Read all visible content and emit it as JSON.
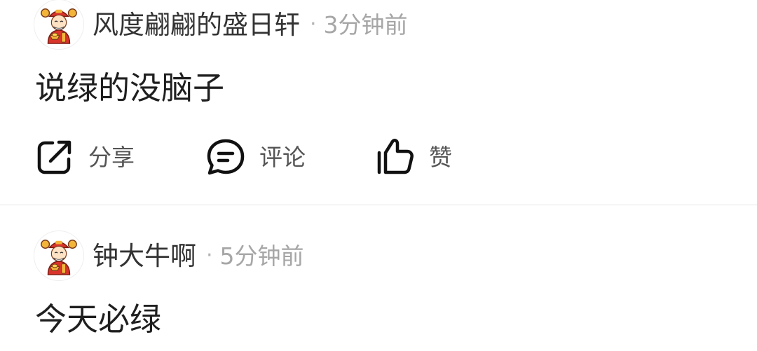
{
  "posts": [
    {
      "username": "风度翩翩的盛日轩",
      "separator": "·",
      "time": "3分钟前",
      "content": "说绿的没脑子",
      "actions": {
        "share_label": "分享",
        "comment_label": "评论",
        "like_label": "赞"
      }
    },
    {
      "username": "钟大牛啊",
      "separator": "·",
      "time": "5分钟前",
      "content": "今天必绿"
    }
  ],
  "icons": {
    "avatar": "god-of-wealth-avatar",
    "share": "share-external-icon",
    "comment": "comment-bubble-icon",
    "like": "thumbs-up-icon"
  },
  "colors": {
    "text_primary": "#1f1f1f",
    "username": "#333333",
    "meta": "#a6a6a6",
    "divider": "#e6e6e6",
    "avatar_red": "#d9342b",
    "avatar_gold": "#f2b53a"
  }
}
